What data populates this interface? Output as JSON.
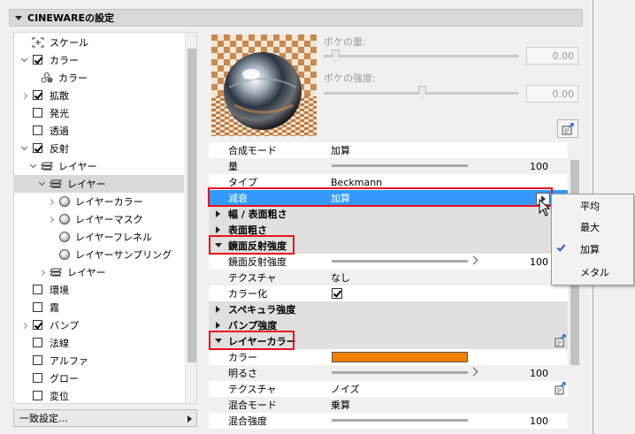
{
  "header": {
    "title": "CINEWAREの設定"
  },
  "tree": {
    "items": [
      {
        "label": "スケール",
        "icon": "scale-icon"
      },
      {
        "label": "カラー",
        "checked": true,
        "expanded": true
      },
      {
        "label": "カラー",
        "icon": "color-channel-icon"
      },
      {
        "label": "拡散",
        "checked": true,
        "expanded": false
      },
      {
        "label": "発光",
        "checked": false
      },
      {
        "label": "透過",
        "checked": false
      },
      {
        "label": "反射",
        "checked": true,
        "expanded": true
      },
      {
        "label": "レイヤー",
        "icon": "layers-icon",
        "expanded": true
      },
      {
        "label": "レイヤー",
        "icon": "layers-icon",
        "expanded": true,
        "selected": true
      },
      {
        "label": "レイヤーカラー",
        "icon": "shader-icon"
      },
      {
        "label": "レイヤーマスク",
        "icon": "shader-icon"
      },
      {
        "label": "レイヤーフレネル",
        "icon": "shader-icon"
      },
      {
        "label": "レイヤーサンプリング",
        "icon": "shader-icon"
      },
      {
        "label": "レイヤー",
        "icon": "layers-icon",
        "expanded": false
      },
      {
        "label": "環境",
        "checked": false
      },
      {
        "label": "霧",
        "checked": false
      },
      {
        "label": "バンプ",
        "checked": true,
        "expanded": false
      },
      {
        "label": "法線",
        "checked": false
      },
      {
        "label": "アルファ",
        "checked": false
      },
      {
        "label": "グロー",
        "checked": false
      },
      {
        "label": "変位",
        "checked": false
      }
    ]
  },
  "bottom_button": {
    "label": "一致設定..."
  },
  "bokeh": {
    "amount_label": "ボケの量:",
    "amount_value": "0.00",
    "strength_label": "ボケの強度:",
    "strength_value": "0.00"
  },
  "props": {
    "blend_mode": {
      "name": "合成モード",
      "value": "加算"
    },
    "amount": {
      "name": "量",
      "value": "100"
    },
    "type": {
      "name": "タイプ",
      "value": "Beckmann"
    },
    "attenuation": {
      "name": "減衰",
      "value": "加算"
    },
    "group_width": "幅 / 表面粗さ",
    "group_roughness": "表面粗さ",
    "group_specular": "鏡面反射強度",
    "specular_strength": {
      "name": "鏡面反射強度",
      "value": "100"
    },
    "texture1": {
      "name": "テクスチャ",
      "value": "なし"
    },
    "colorize": {
      "name": "カラー化",
      "checked": true
    },
    "group_specular_intensity": "スペキュラ強度",
    "group_bump_strength": "バンプ強度",
    "group_layer_color": "レイヤーカラー",
    "color": {
      "name": "カラー",
      "value_hex": "#f08000"
    },
    "brightness": {
      "name": "明るさ",
      "value": "100"
    },
    "texture2": {
      "name": "テクスチャ",
      "value": "ノイズ"
    },
    "mix_mode": {
      "name": "混合モード",
      "value": "乗算"
    },
    "mix_strength": {
      "name": "混合強度",
      "value": "100"
    }
  },
  "dropdown_menu": {
    "items": [
      {
        "label": "平均",
        "checked": false
      },
      {
        "label": "最大",
        "checked": false
      },
      {
        "label": "加算",
        "checked": true
      },
      {
        "label": "メタル",
        "checked": false
      }
    ]
  },
  "colors": {
    "highlight": "#3399ff",
    "annotation_red": "#e8121e",
    "layer_color": "#f08000"
  }
}
